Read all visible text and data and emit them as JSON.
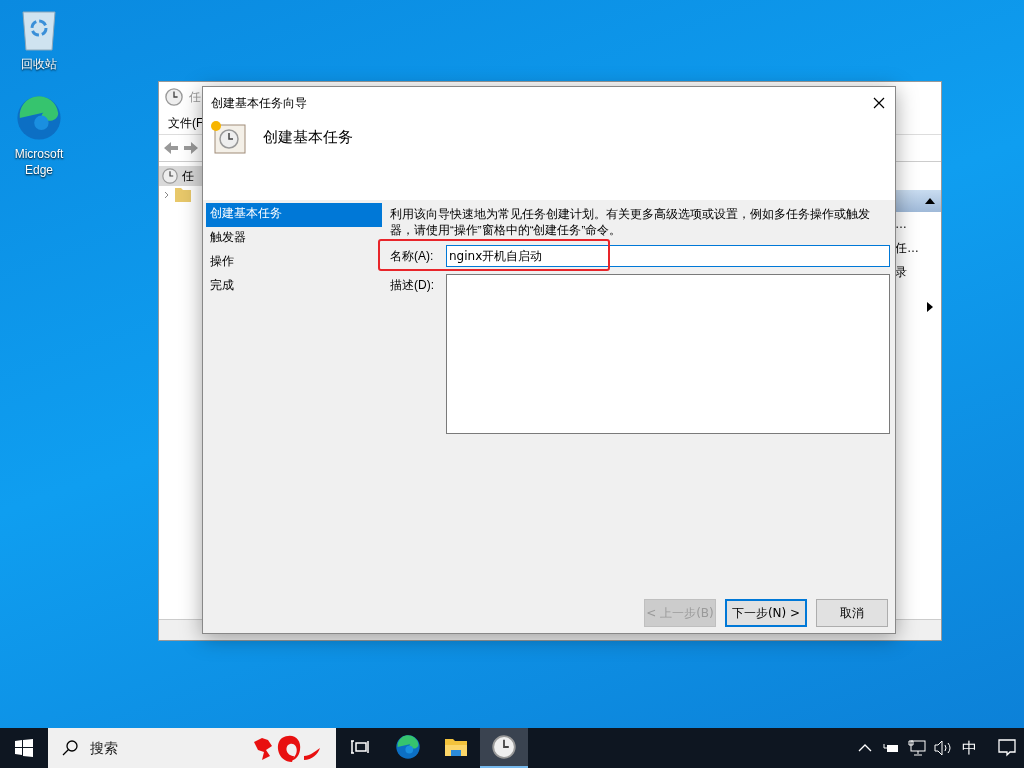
{
  "desktop_icons": [
    {
      "kind": "recycle",
      "label": "回收站"
    },
    {
      "kind": "edge",
      "label": "Microsoft Edge"
    }
  ],
  "background_window": {
    "title": "任",
    "menu": [
      "文件(F"
    ],
    "tree": [
      {
        "label": "任",
        "selected": true
      }
    ],
    "actions": [
      "…",
      "任…",
      "录"
    ]
  },
  "wizard": {
    "title": "创建基本任务向导",
    "heading": "创建基本任务",
    "steps": [
      {
        "label": "创建基本任务",
        "selected": true
      },
      {
        "label": "触发器",
        "selected": false
      },
      {
        "label": "操作",
        "selected": false
      },
      {
        "label": "完成",
        "selected": false
      }
    ],
    "intro": "利用该向导快速地为常见任务创建计划。有关更多高级选项或设置，例如多任务操作或触发器，请使用“操作”窗格中的“创建任务”命令。",
    "name_label": "名称(A):",
    "name_value": "nginx开机自启动",
    "highlighted": true,
    "description_label": "描述(D):",
    "buttons": [
      {
        "label": "< 上一步(B)",
        "disabled": true,
        "default": false
      },
      {
        "label": "下一步(N) >",
        "disabled": false,
        "default": true
      },
      {
        "label": "取消",
        "disabled": false,
        "default": false
      }
    ]
  },
  "taskbar": {
    "search_placeholder": "搜索",
    "apps": [
      {
        "kind": "taskview",
        "selected": false
      },
      {
        "kind": "edge",
        "selected": false
      },
      {
        "kind": "explorer",
        "selected": false
      },
      {
        "kind": "scheduler",
        "selected": true
      }
    ],
    "ime": "中"
  }
}
